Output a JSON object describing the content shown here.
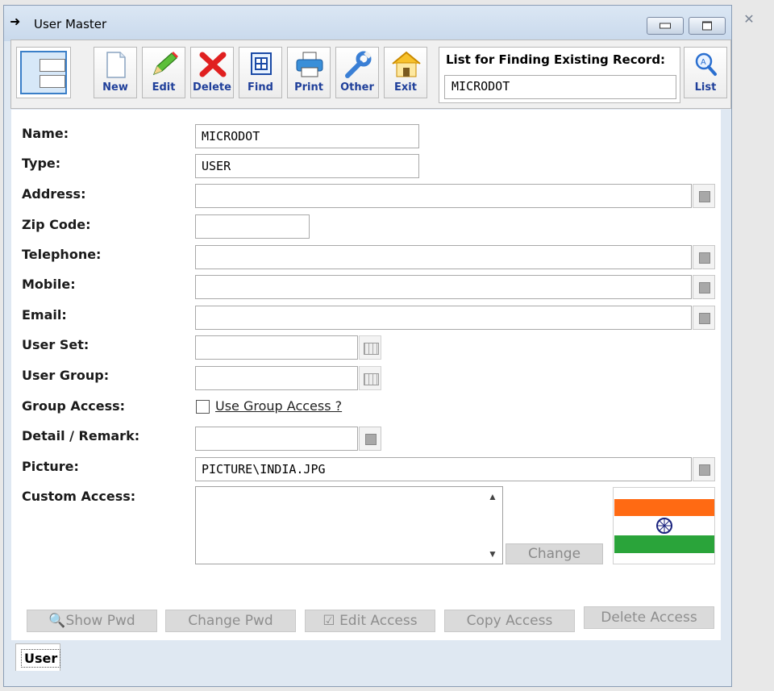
{
  "window": {
    "title": "User Master"
  },
  "toolbar": {
    "buttons": [
      {
        "label": "New",
        "icon": "new-document-icon"
      },
      {
        "label": "Edit",
        "icon": "pencil-icon"
      },
      {
        "label": "Delete",
        "icon": "red-x-icon"
      },
      {
        "label": "Find",
        "icon": "find-grid-icon"
      },
      {
        "label": "Print",
        "icon": "printer-icon"
      },
      {
        "label": "Other",
        "icon": "wrench-icon"
      },
      {
        "label": "Exit",
        "icon": "house-icon"
      }
    ],
    "find_title": "List for Finding Existing Record:",
    "find_value": "MICRODOT",
    "list_label": "List"
  },
  "form": {
    "name_label": "Name:",
    "name_value": "MICRODOT",
    "type_label": "Type:",
    "type_value": "USER",
    "address_label": "Address:",
    "address_value": "",
    "zip_label": "Zip Code:",
    "zip_value": "",
    "telephone_label": "Telephone:",
    "telephone_value": "",
    "mobile_label": "Mobile:",
    "mobile_value": "",
    "email_label": "Email:",
    "email_value": "",
    "userset_label": "User Set:",
    "userset_value": "",
    "usergroup_label": "User Group:",
    "usergroup_value": "",
    "groupaccess_label": "Group Access:",
    "groupaccess_checkbox": "Use Group Access ?",
    "detail_label": "Detail / Remark:",
    "detail_value": "",
    "picture_label": "Picture:",
    "picture_value": "PICTURE\\INDIA.JPG",
    "custom_label": "Custom Access:",
    "change_label": "Change"
  },
  "bottom_buttons": [
    "Show Pwd",
    "Change Pwd",
    "Edit Access",
    "Copy Access",
    "Delete Access"
  ],
  "tab": {
    "label": "User"
  },
  "colors": {
    "accent": "#1f3f9a",
    "flag_saffron": "#ff6a13",
    "flag_green": "#2aa43a",
    "chakra": "#1a237e"
  }
}
